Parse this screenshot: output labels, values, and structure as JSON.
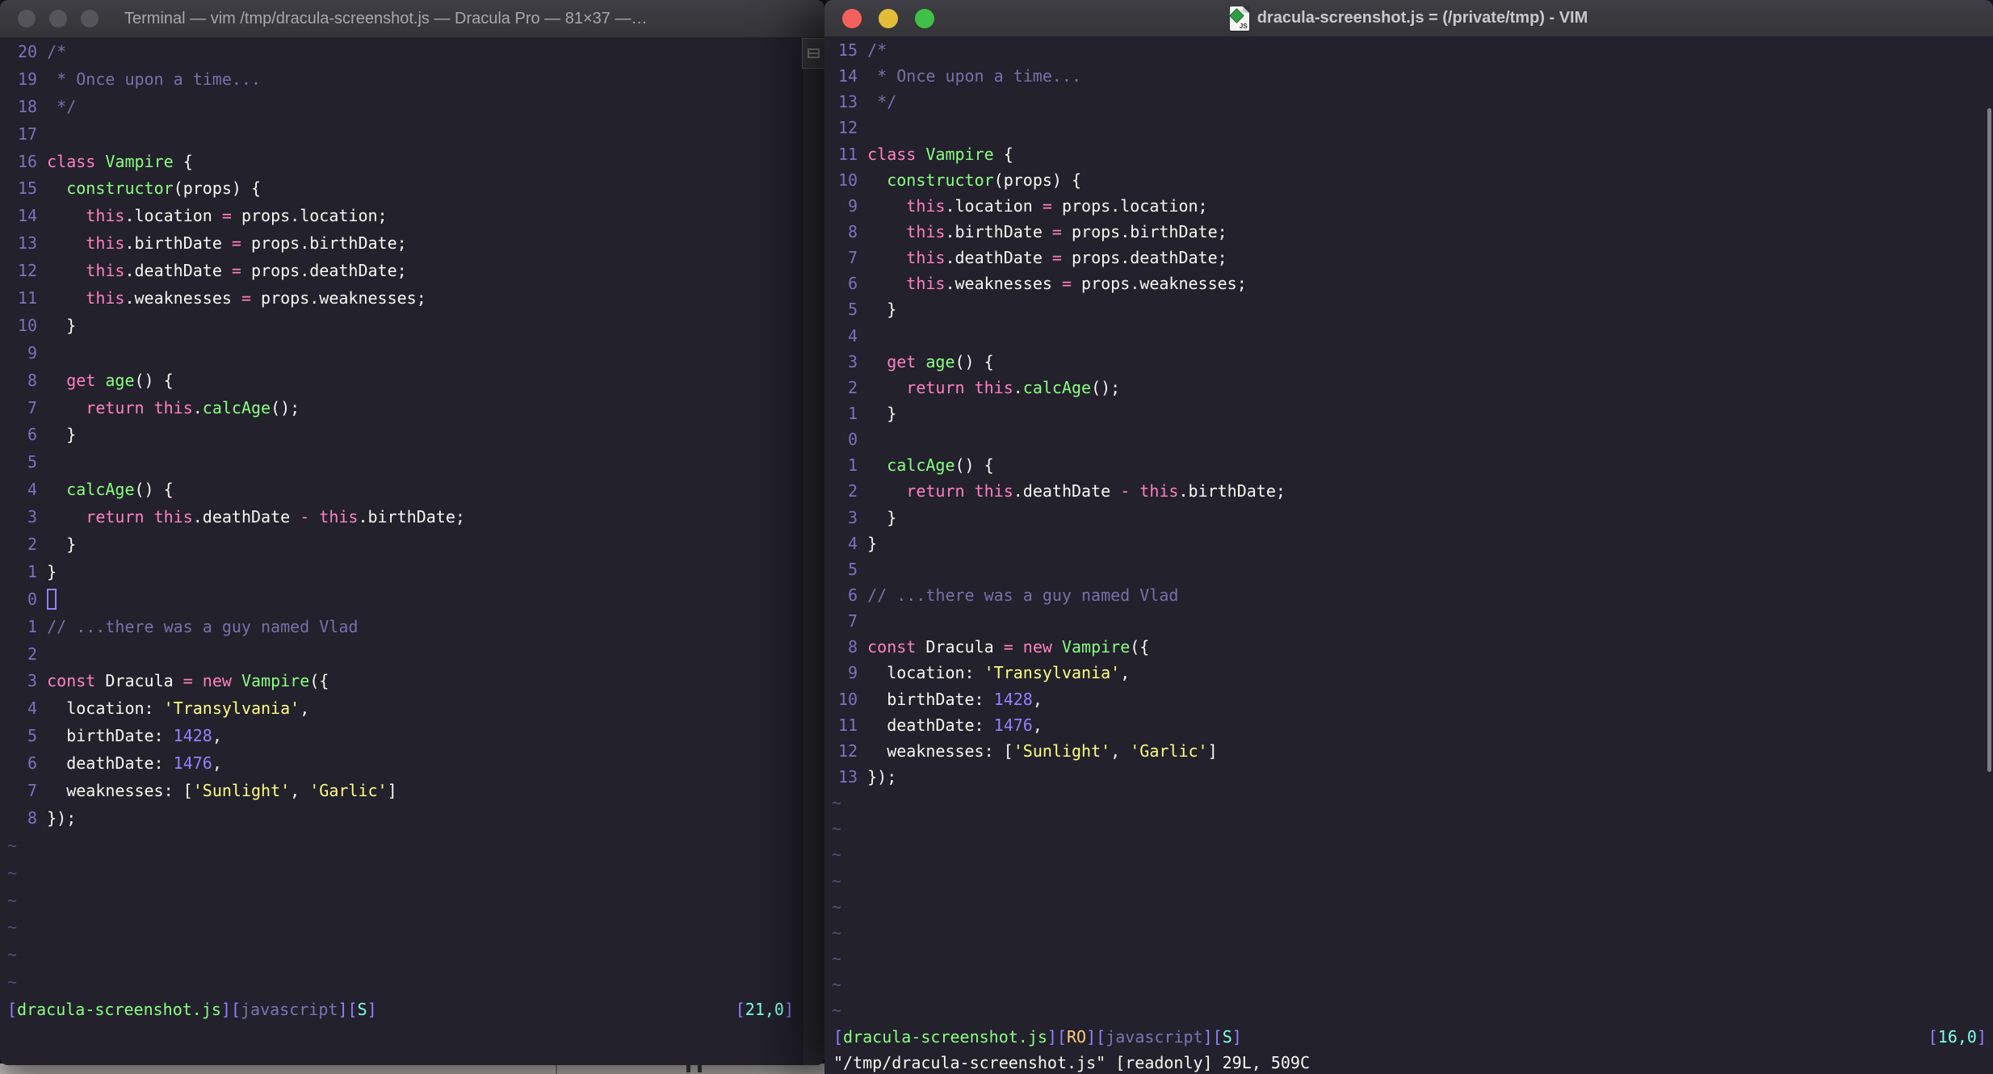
{
  "palette": {
    "background": "#22212C",
    "foreground": "#F8F8F2",
    "comment": "#7970A9",
    "pink": "#FF80BF",
    "green": "#8AFF80",
    "purple": "#9580FF",
    "yellow": "#FFFF80",
    "cyan": "#80FFEA",
    "orange": "#FFCA80",
    "titlebar": "#3a393f",
    "traffic_red": "#F4615C",
    "traffic_yellow": "#E3BD39",
    "traffic_green": "#3EC146"
  },
  "left_window": {
    "title": "Terminal — vim /tmp/dracula-screenshot.js — Dracula Pro — 81×37 —…",
    "rows": [
      {
        "n": "20",
        "t": [
          [
            "c",
            "/*"
          ]
        ]
      },
      {
        "n": "19",
        "t": [
          [
            "c",
            " * Once upon a time..."
          ]
        ]
      },
      {
        "n": "18",
        "t": [
          [
            "c",
            " */"
          ]
        ]
      },
      {
        "n": "17",
        "t": []
      },
      {
        "n": "16",
        "t": [
          [
            "p",
            "class"
          ],
          [
            "w",
            " "
          ],
          [
            "g",
            "Vampire"
          ],
          [
            "w",
            " {"
          ]
        ]
      },
      {
        "n": "15",
        "t": [
          [
            "w",
            "  "
          ],
          [
            "g",
            "constructor"
          ],
          [
            "w",
            "(props) {"
          ]
        ]
      },
      {
        "n": "14",
        "t": [
          [
            "w",
            "    "
          ],
          [
            "p",
            "this"
          ],
          [
            "w",
            ".location "
          ],
          [
            "p",
            "="
          ],
          [
            "w",
            " props.location;"
          ]
        ]
      },
      {
        "n": "13",
        "t": [
          [
            "w",
            "    "
          ],
          [
            "p",
            "this"
          ],
          [
            "w",
            ".birthDate "
          ],
          [
            "p",
            "="
          ],
          [
            "w",
            " props.birthDate;"
          ]
        ]
      },
      {
        "n": "12",
        "t": [
          [
            "w",
            "    "
          ],
          [
            "p",
            "this"
          ],
          [
            "w",
            ".deathDate "
          ],
          [
            "p",
            "="
          ],
          [
            "w",
            " props.deathDate;"
          ]
        ]
      },
      {
        "n": "11",
        "t": [
          [
            "w",
            "    "
          ],
          [
            "p",
            "this"
          ],
          [
            "w",
            ".weaknesses "
          ],
          [
            "p",
            "="
          ],
          [
            "w",
            " props.weaknesses;"
          ]
        ]
      },
      {
        "n": "10",
        "t": [
          [
            "w",
            "  }"
          ]
        ]
      },
      {
        "n": "9",
        "t": []
      },
      {
        "n": "8",
        "t": [
          [
            "w",
            "  "
          ],
          [
            "p",
            "get"
          ],
          [
            "w",
            " "
          ],
          [
            "g",
            "age"
          ],
          [
            "w",
            "() {"
          ]
        ]
      },
      {
        "n": "7",
        "t": [
          [
            "w",
            "    "
          ],
          [
            "p",
            "return"
          ],
          [
            "w",
            " "
          ],
          [
            "p",
            "this"
          ],
          [
            "w",
            "."
          ],
          [
            "g",
            "calcAge"
          ],
          [
            "w",
            "();"
          ]
        ]
      },
      {
        "n": "6",
        "t": [
          [
            "w",
            "  }"
          ]
        ]
      },
      {
        "n": "5",
        "t": []
      },
      {
        "n": "4",
        "t": [
          [
            "w",
            "  "
          ],
          [
            "g",
            "calcAge"
          ],
          [
            "w",
            "() {"
          ]
        ]
      },
      {
        "n": "3",
        "t": [
          [
            "w",
            "    "
          ],
          [
            "p",
            "return"
          ],
          [
            "w",
            " "
          ],
          [
            "p",
            "this"
          ],
          [
            "w",
            ".deathDate "
          ],
          [
            "p",
            "-"
          ],
          [
            "w",
            " "
          ],
          [
            "p",
            "this"
          ],
          [
            "w",
            ".birthDate;"
          ]
        ]
      },
      {
        "n": "2",
        "t": [
          [
            "w",
            "  }"
          ]
        ]
      },
      {
        "n": "1",
        "t": [
          [
            "w",
            "}"
          ]
        ]
      },
      {
        "n": "0",
        "cursor": true,
        "t": []
      },
      {
        "n": "1",
        "t": [
          [
            "c",
            "// ...there was a guy named Vlad"
          ]
        ]
      },
      {
        "n": "2",
        "t": []
      },
      {
        "n": "3",
        "t": [
          [
            "p",
            "const"
          ],
          [
            "w",
            " Dracula "
          ],
          [
            "p",
            "="
          ],
          [
            "w",
            " "
          ],
          [
            "p",
            "new"
          ],
          [
            "w",
            " "
          ],
          [
            "g",
            "Vampire"
          ],
          [
            "w",
            "({"
          ]
        ]
      },
      {
        "n": "4",
        "t": [
          [
            "w",
            "  location: "
          ],
          [
            "y",
            "'Transylvania'"
          ],
          [
            "w",
            ","
          ]
        ]
      },
      {
        "n": "5",
        "t": [
          [
            "w",
            "  birthDate: "
          ],
          [
            "pu",
            "1428"
          ],
          [
            "w",
            ","
          ]
        ]
      },
      {
        "n": "6",
        "t": [
          [
            "w",
            "  deathDate: "
          ],
          [
            "pu",
            "1476"
          ],
          [
            "w",
            ","
          ]
        ]
      },
      {
        "n": "7",
        "t": [
          [
            "w",
            "  weaknesses: ["
          ],
          [
            "y",
            "'Sunlight'"
          ],
          [
            "w",
            ", "
          ],
          [
            "y",
            "'Garlic'"
          ],
          [
            "w",
            "]"
          ]
        ]
      },
      {
        "n": "8",
        "t": [
          [
            "w",
            "});"
          ]
        ]
      },
      {
        "tilde": true
      },
      {
        "tilde": true
      },
      {
        "tilde": true
      },
      {
        "tilde": true
      },
      {
        "tilde": true
      },
      {
        "tilde": true
      }
    ],
    "status_left": [
      [
        "pu",
        "["
      ],
      [
        "g",
        "dracula-screenshot.js"
      ],
      [
        "pu",
        "]["
      ],
      [
        "ft",
        "javascript"
      ],
      [
        "pu",
        "]["
      ],
      [
        "cy",
        "S"
      ],
      [
        "pu",
        "]"
      ]
    ],
    "status_right": [
      [
        "pu",
        "["
      ],
      [
        "cy",
        "21,0"
      ],
      [
        "pu",
        "]"
      ]
    ],
    "cmdline": []
  },
  "right_window": {
    "title": "dracula-screenshot.js = (/private/tmp) - VIM",
    "rows": [
      {
        "n": "15",
        "t": [
          [
            "c",
            "/*"
          ]
        ]
      },
      {
        "n": "14",
        "t": [
          [
            "c",
            " * Once upon a time..."
          ]
        ]
      },
      {
        "n": "13",
        "t": [
          [
            "c",
            " */"
          ]
        ]
      },
      {
        "n": "12",
        "t": []
      },
      {
        "n": "11",
        "t": [
          [
            "p",
            "class"
          ],
          [
            "w",
            " "
          ],
          [
            "g",
            "Vampire"
          ],
          [
            "w",
            " {"
          ]
        ]
      },
      {
        "n": "10",
        "t": [
          [
            "w",
            "  "
          ],
          [
            "g",
            "constructor"
          ],
          [
            "w",
            "(props) {"
          ]
        ]
      },
      {
        "n": "9",
        "t": [
          [
            "w",
            "    "
          ],
          [
            "p",
            "this"
          ],
          [
            "w",
            ".location "
          ],
          [
            "p",
            "="
          ],
          [
            "w",
            " props.location;"
          ]
        ]
      },
      {
        "n": "8",
        "t": [
          [
            "w",
            "    "
          ],
          [
            "p",
            "this"
          ],
          [
            "w",
            ".birthDate "
          ],
          [
            "p",
            "="
          ],
          [
            "w",
            " props.birthDate;"
          ]
        ]
      },
      {
        "n": "7",
        "t": [
          [
            "w",
            "    "
          ],
          [
            "p",
            "this"
          ],
          [
            "w",
            ".deathDate "
          ],
          [
            "p",
            "="
          ],
          [
            "w",
            " props.deathDate;"
          ]
        ]
      },
      {
        "n": "6",
        "t": [
          [
            "w",
            "    "
          ],
          [
            "p",
            "this"
          ],
          [
            "w",
            ".weaknesses "
          ],
          [
            "p",
            "="
          ],
          [
            "w",
            " props.weaknesses;"
          ]
        ]
      },
      {
        "n": "5",
        "t": [
          [
            "w",
            "  }"
          ]
        ]
      },
      {
        "n": "4",
        "t": []
      },
      {
        "n": "3",
        "t": [
          [
            "w",
            "  "
          ],
          [
            "p",
            "get"
          ],
          [
            "w",
            " "
          ],
          [
            "g",
            "age"
          ],
          [
            "w",
            "() {"
          ]
        ]
      },
      {
        "n": "2",
        "t": [
          [
            "w",
            "    "
          ],
          [
            "p",
            "return"
          ],
          [
            "w",
            " "
          ],
          [
            "p",
            "this"
          ],
          [
            "w",
            "."
          ],
          [
            "g",
            "calcAge"
          ],
          [
            "w",
            "();"
          ]
        ]
      },
      {
        "n": "1",
        "t": [
          [
            "w",
            "  }"
          ]
        ]
      },
      {
        "n": "0",
        "t": []
      },
      {
        "n": "1",
        "t": [
          [
            "w",
            "  "
          ],
          [
            "g",
            "calcAge"
          ],
          [
            "w",
            "() {"
          ]
        ]
      },
      {
        "n": "2",
        "t": [
          [
            "w",
            "    "
          ],
          [
            "p",
            "return"
          ],
          [
            "w",
            " "
          ],
          [
            "p",
            "this"
          ],
          [
            "w",
            ".deathDate "
          ],
          [
            "p",
            "-"
          ],
          [
            "w",
            " "
          ],
          [
            "p",
            "this"
          ],
          [
            "w",
            ".birthDate;"
          ]
        ]
      },
      {
        "n": "3",
        "t": [
          [
            "w",
            "  }"
          ]
        ]
      },
      {
        "n": "4",
        "t": [
          [
            "w",
            "}"
          ]
        ]
      },
      {
        "n": "5",
        "t": []
      },
      {
        "n": "6",
        "t": [
          [
            "c",
            "// ...there was a guy named Vlad"
          ]
        ]
      },
      {
        "n": "7",
        "t": []
      },
      {
        "n": "8",
        "t": [
          [
            "p",
            "const"
          ],
          [
            "w",
            " Dracula "
          ],
          [
            "p",
            "="
          ],
          [
            "w",
            " "
          ],
          [
            "p",
            "new"
          ],
          [
            "w",
            " "
          ],
          [
            "g",
            "Vampire"
          ],
          [
            "w",
            "({"
          ]
        ]
      },
      {
        "n": "9",
        "t": [
          [
            "w",
            "  location: "
          ],
          [
            "y",
            "'Transylvania'"
          ],
          [
            "w",
            ","
          ]
        ]
      },
      {
        "n": "10",
        "t": [
          [
            "w",
            "  birthDate: "
          ],
          [
            "pu",
            "1428"
          ],
          [
            "w",
            ","
          ]
        ]
      },
      {
        "n": "11",
        "t": [
          [
            "w",
            "  deathDate: "
          ],
          [
            "pu",
            "1476"
          ],
          [
            "w",
            ","
          ]
        ]
      },
      {
        "n": "12",
        "t": [
          [
            "w",
            "  weaknesses: ["
          ],
          [
            "y",
            "'Sunlight'"
          ],
          [
            "w",
            ", "
          ],
          [
            "y",
            "'Garlic'"
          ],
          [
            "w",
            "]"
          ]
        ]
      },
      {
        "n": "13",
        "t": [
          [
            "w",
            "});"
          ]
        ]
      },
      {
        "tilde": true
      },
      {
        "tilde": true
      },
      {
        "tilde": true
      },
      {
        "tilde": true
      },
      {
        "tilde": true
      },
      {
        "tilde": true
      },
      {
        "tilde": true
      },
      {
        "tilde": true
      },
      {
        "tilde": true
      }
    ],
    "status_left": [
      [
        "pu",
        "["
      ],
      [
        "g",
        "dracula-screenshot.js"
      ],
      [
        "pu",
        "]["
      ],
      [
        "o",
        "RO"
      ],
      [
        "pu",
        "]["
      ],
      [
        "ft",
        "javascript"
      ],
      [
        "pu",
        "]["
      ],
      [
        "cy",
        "S"
      ],
      [
        "pu",
        "]"
      ]
    ],
    "status_right": [
      [
        "pu",
        "["
      ],
      [
        "cy",
        "16,0"
      ],
      [
        "pu",
        "]"
      ]
    ],
    "cmdline": [
      [
        "w",
        "\"/tmp/dracula-screenshot.js\" [readonly] 29L, 509C"
      ]
    ]
  }
}
